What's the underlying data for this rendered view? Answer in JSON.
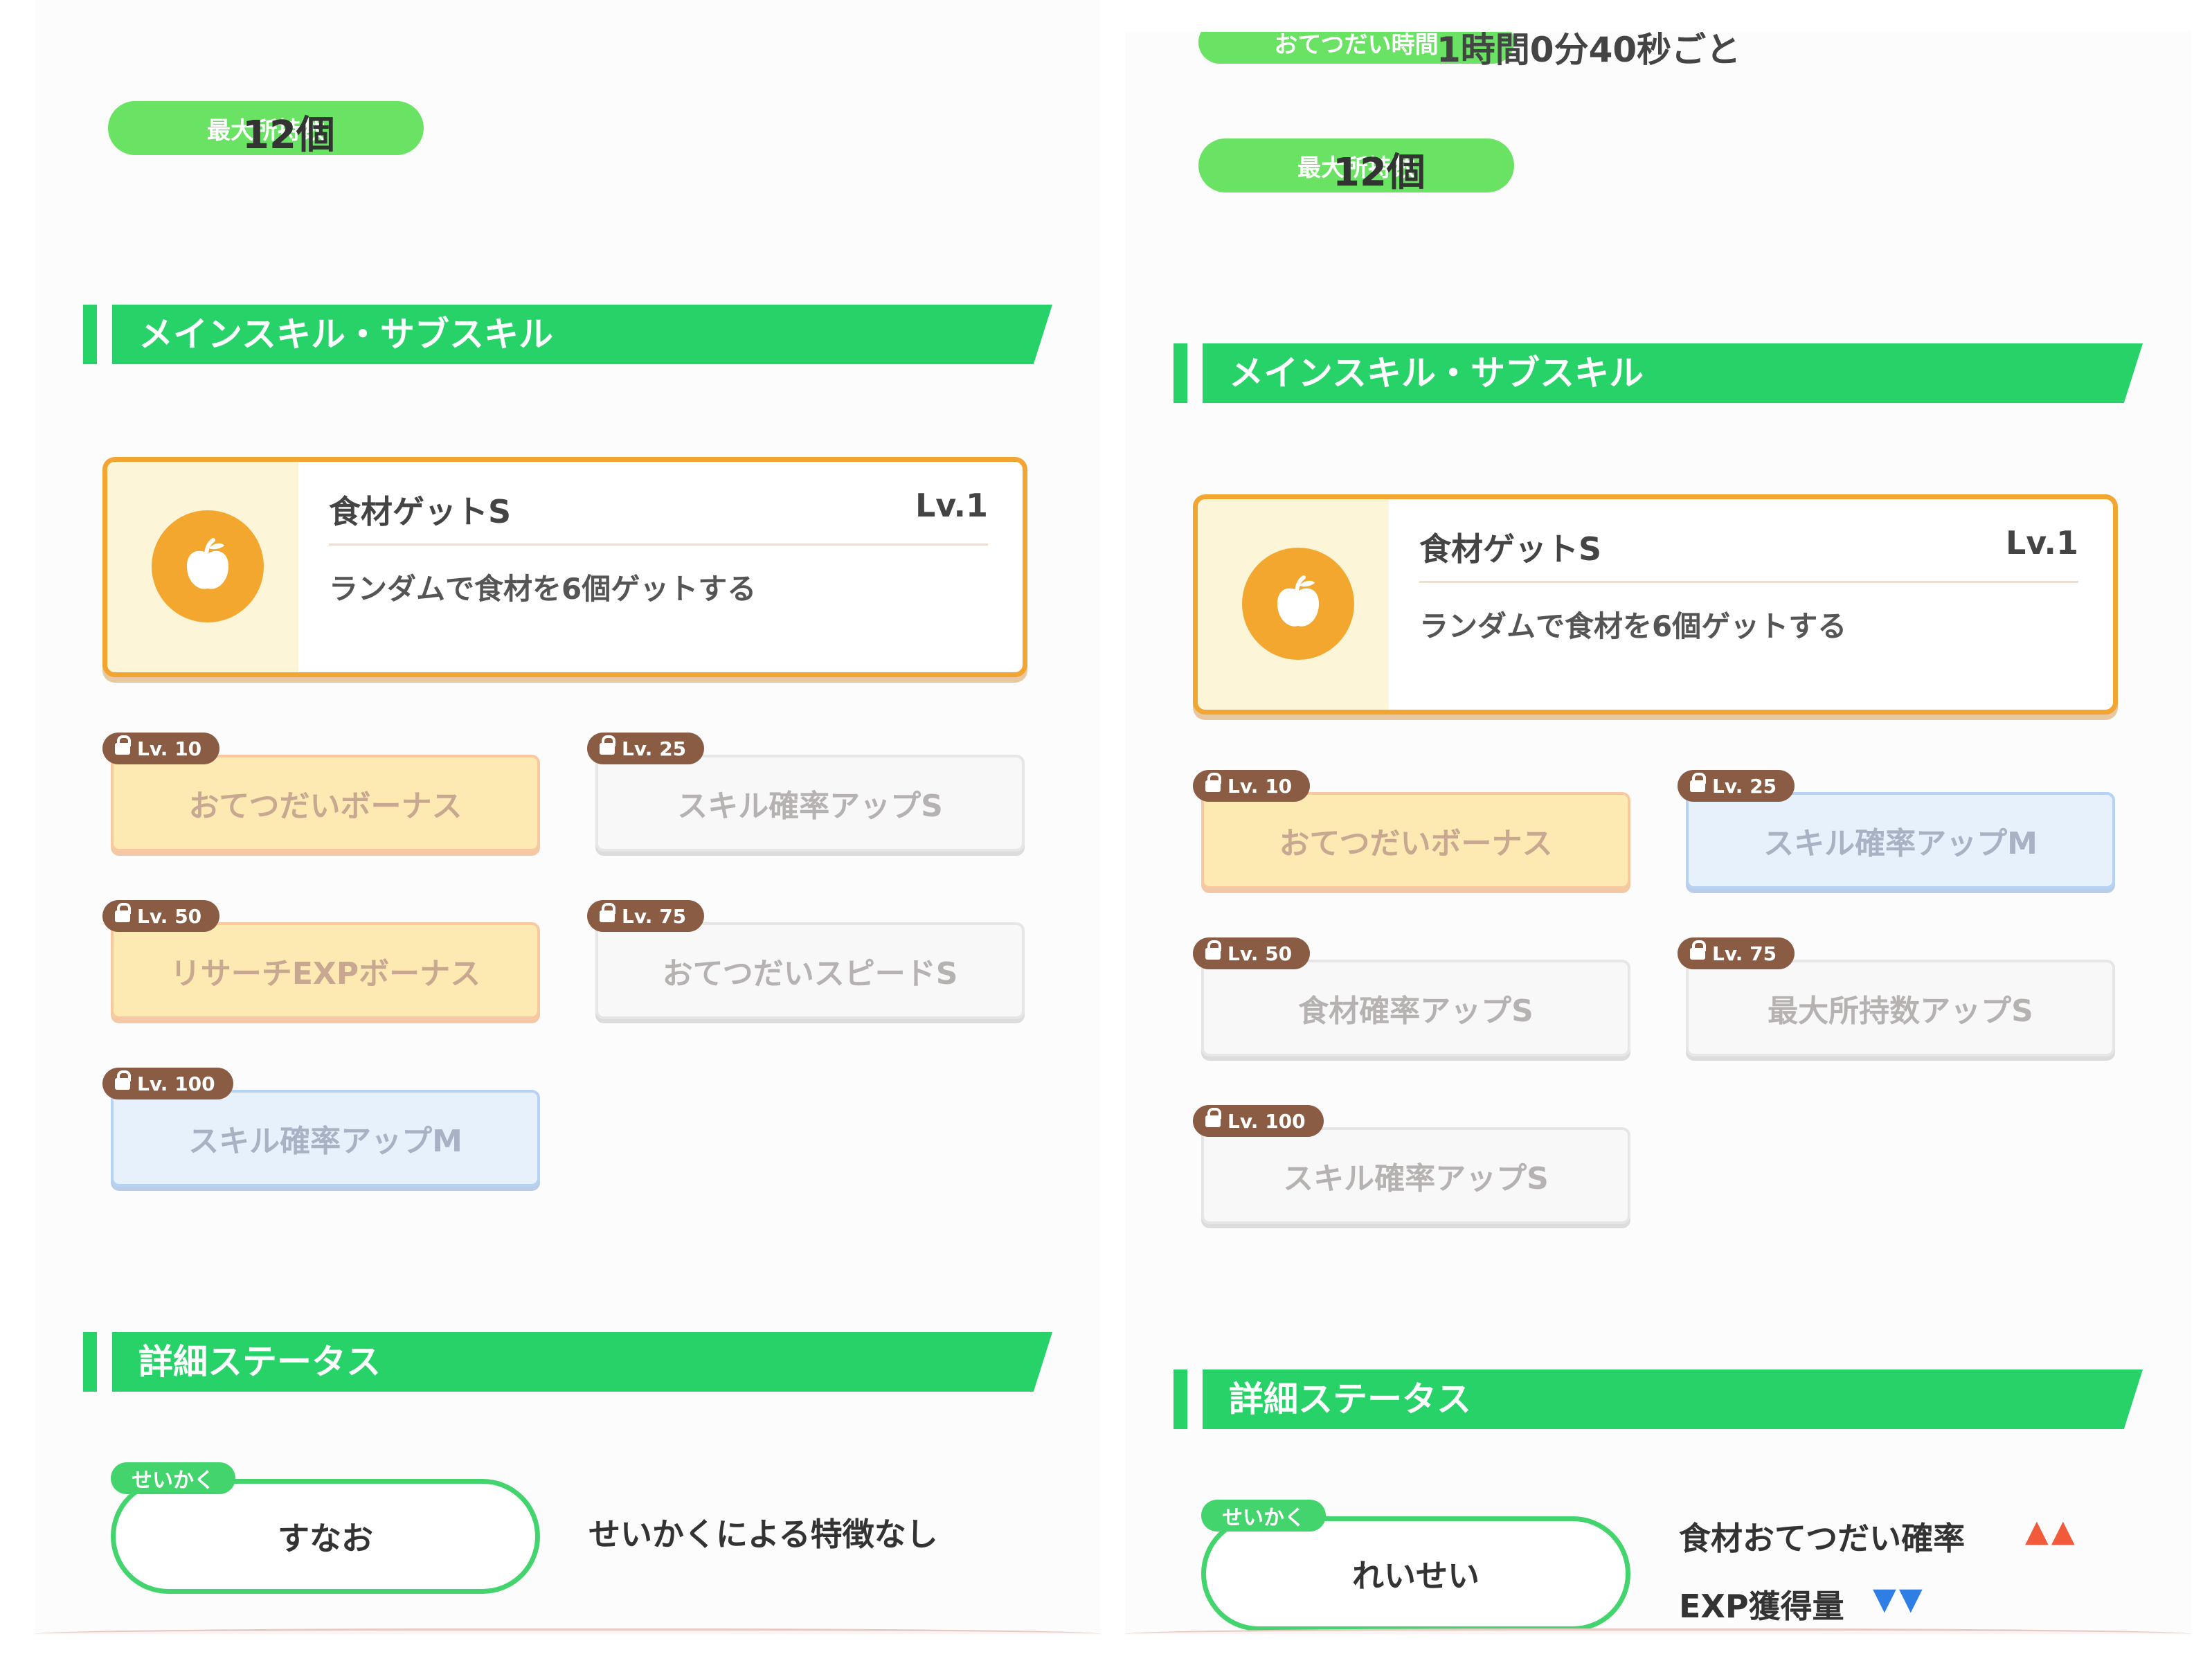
{
  "left": {
    "stat_label": "最大所持数",
    "stat_value": "12個",
    "section_skills": "メインスキル・サブスキル",
    "main_skill": {
      "name": "食材ゲットS",
      "level": "Lv.1",
      "description": "ランダムで食材を6個ゲットする"
    },
    "sub_skills": [
      {
        "level": "Lv. 10",
        "name": "おてつだいボーナス",
        "style": "orange"
      },
      {
        "level": "Lv. 25",
        "name": "スキル確率アップS",
        "style": "gray"
      },
      {
        "level": "Lv. 50",
        "name": "リサーチEXPボーナス",
        "style": "orange"
      },
      {
        "level": "Lv. 75",
        "name": "おてつだいスピードS",
        "style": "gray"
      },
      {
        "level": "Lv. 100",
        "name": "スキル確率アップM",
        "style": "blue"
      }
    ],
    "section_status": "詳細ステータス",
    "nature_tag": "せいかく",
    "nature_name": "すなお",
    "nature_effect": "せいかくによる特徴なし"
  },
  "right": {
    "top_label": "おてつだい時間",
    "top_value": "1時間0分40秒ごと",
    "stat_label": "最大所持数",
    "stat_value": "12個",
    "section_skills": "メインスキル・サブスキル",
    "main_skill": {
      "name": "食材ゲットS",
      "level": "Lv.1",
      "description": "ランダムで食材を6個ゲットする"
    },
    "sub_skills": [
      {
        "level": "Lv. 10",
        "name": "おてつだいボーナス",
        "style": "orange"
      },
      {
        "level": "Lv. 25",
        "name": "スキル確率アップM",
        "style": "blue"
      },
      {
        "level": "Lv. 50",
        "name": "食材確率アップS",
        "style": "gray"
      },
      {
        "level": "Lv. 75",
        "name": "最大所持数アップS",
        "style": "gray"
      },
      {
        "level": "Lv. 100",
        "name": "スキル確率アップS",
        "style": "gray"
      }
    ],
    "section_status": "詳細ステータス",
    "nature_tag": "せいかく",
    "nature_name": "れいせい",
    "nature_up_label": "食材おてつだい確率",
    "nature_up_arrows": "▲▲",
    "nature_down_label": "EXP獲得量",
    "nature_down_arrows": "▼▼"
  },
  "icons": {
    "main_skill_icon": "apple-icon",
    "lock_icon": "lock-icon"
  },
  "colors": {
    "accent_green": "#27d369",
    "pill_green": "#6ae364",
    "skill_orange": "#f2a531",
    "level_brown": "#8a5c43",
    "up_red": "#f25a3c",
    "down_blue": "#2f7ee6"
  }
}
